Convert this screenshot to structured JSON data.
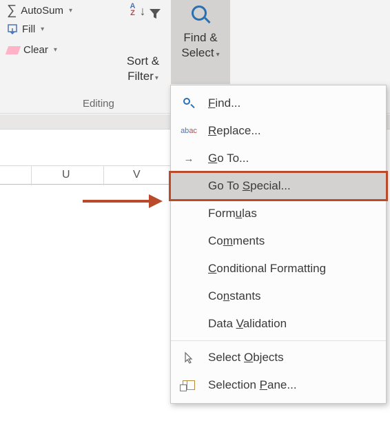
{
  "ribbon": {
    "autosum": {
      "label": "AutoSum"
    },
    "fill": {
      "label": "Fill"
    },
    "clear": {
      "label": "Clear"
    },
    "group_label": "Editing",
    "sortfilter": {
      "line1": "Sort &",
      "line2": "Filter"
    },
    "findselect": {
      "line1": "Find &",
      "line2": "Select"
    }
  },
  "columns": {
    "u": "U",
    "v": "V"
  },
  "menu": {
    "find": "Find...",
    "find_ul": "F",
    "replace": "Replace...",
    "replace_ul": "R",
    "goto": "Go To...",
    "goto_ul": "G",
    "special": "Go To Special...",
    "special_ul": "S",
    "formulas": "Formulas",
    "formulas_ul": "u",
    "comments": "Comments",
    "comments_ul": "m",
    "condfmt": "Conditional Formatting",
    "condfmt_ul": "C",
    "constants": "Constants",
    "constants_ul": "n",
    "datavalid": "Data Validation",
    "datavalid_ul": "V",
    "objects": "Select Objects",
    "objects_ul": "O",
    "pane": "Selection Pane...",
    "pane_ul": "P"
  }
}
